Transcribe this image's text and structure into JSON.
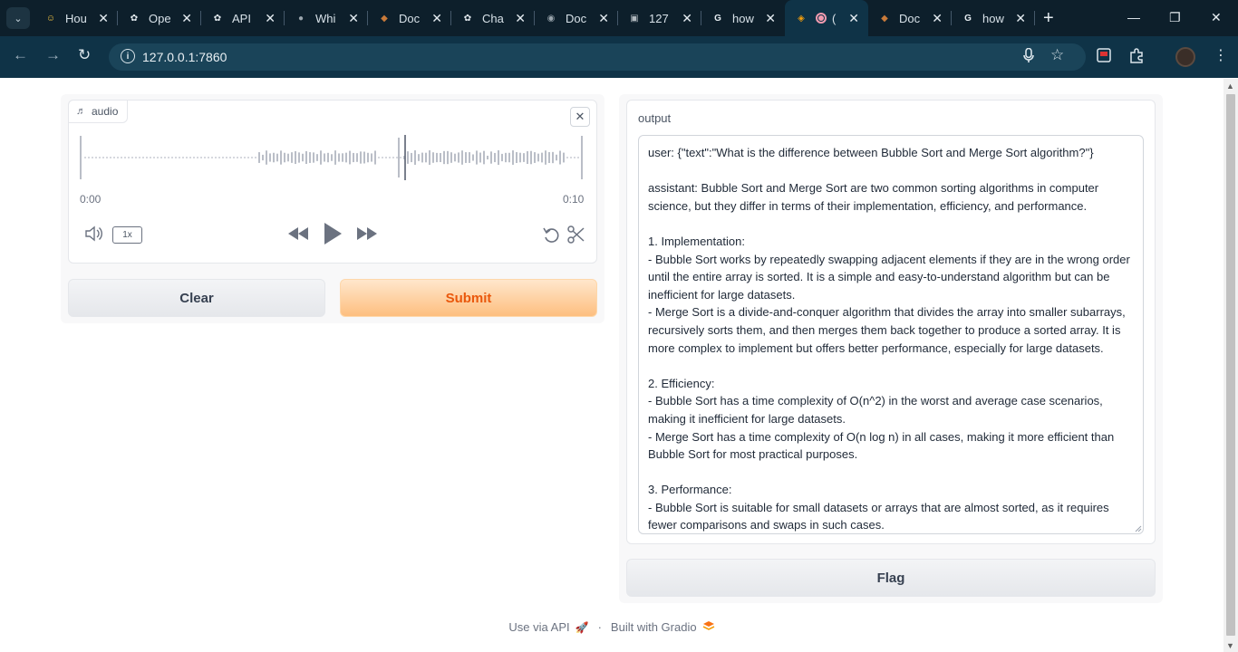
{
  "browser": {
    "tabs": [
      {
        "title": "Hou",
        "favicon": "hugging-face-icon",
        "color": "#f5c542"
      },
      {
        "title": "Ope",
        "favicon": "openai-icon",
        "color": "#e6edf2"
      },
      {
        "title": "API",
        "favicon": "openai-icon",
        "color": "#e6edf2"
      },
      {
        "title": "Whi",
        "favicon": "github-icon",
        "color": "#9aa5ad"
      },
      {
        "title": "Doc",
        "favicon": "docs-avatar-icon",
        "color": "#c87a3a"
      },
      {
        "title": "Cha",
        "favicon": "chatgpt-icon",
        "color": "#e6edf2"
      },
      {
        "title": "Doc",
        "favicon": "globe-icon",
        "color": "#9aa5ad"
      },
      {
        "title": "127",
        "favicon": "image-icon",
        "color": "#b0b8be"
      },
      {
        "title": "how",
        "favicon": "google-icon",
        "color": "#e6edf2"
      },
      {
        "title": "(",
        "favicon": "gradio-icon",
        "color": "#f59e0b",
        "active": true
      },
      {
        "title": "Doc",
        "favicon": "docs-avatar-icon",
        "color": "#c87a3a"
      },
      {
        "title": "how",
        "favicon": "google-icon",
        "color": "#e6edf2"
      }
    ],
    "url": "127.0.0.1:7860"
  },
  "audio": {
    "label": "audio",
    "time_start": "0:00",
    "time_end": "0:10",
    "speed": "1x"
  },
  "buttons": {
    "clear": "Clear",
    "submit": "Submit",
    "flag": "Flag"
  },
  "output": {
    "label": "output",
    "text": "user: {\"text\":\"What is the difference between Bubble Sort and Merge Sort algorithm?\"}\n\nassistant: Bubble Sort and Merge Sort are two common sorting algorithms in computer science, but they differ in terms of their implementation, efficiency, and performance.\n\n1. Implementation:\n- Bubble Sort works by repeatedly swapping adjacent elements if they are in the wrong order until the entire array is sorted. It is a simple and easy-to-understand algorithm but can be inefficient for large datasets.\n- Merge Sort is a divide-and-conquer algorithm that divides the array into smaller subarrays, recursively sorts them, and then merges them back together to produce a sorted array. It is more complex to implement but offers better performance, especially for large datasets.\n\n2. Efficiency:\n- Bubble Sort has a time complexity of O(n^2) in the worst and average case scenarios, making it inefficient for large datasets.\n- Merge Sort has a time complexity of O(n log n) in all cases, making it more efficient than Bubble Sort for most practical purposes.\n\n3. Performance:\n- Bubble Sort is suitable for small datasets or arrays that are almost sorted, as it requires fewer comparisons and swaps in such cases."
  },
  "footer": {
    "api_link": "Use via API",
    "separator": "·",
    "built_with": "Built with Gradio"
  }
}
